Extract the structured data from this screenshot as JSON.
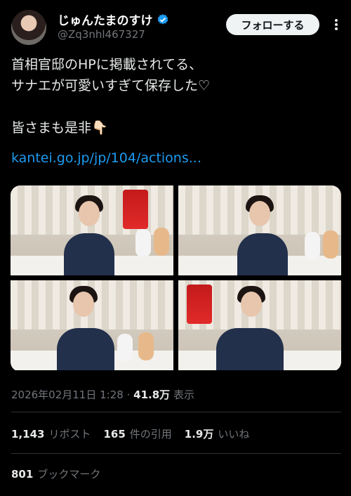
{
  "user": {
    "display_name": "じゅんたまのすけ",
    "handle": "@Zq3nhl467327",
    "verified_icon": "verified-badge-icon"
  },
  "header": {
    "follow_label": "フォローする",
    "more_icon": "more-icon"
  },
  "tweet": {
    "text": "首相官邸のHPに掲載されてる、\nサナエが可愛いすぎて保存した♡\n\n皆さまも是非👇🏻",
    "link": "kantei.go.jp/jp/104/actions..."
  },
  "media": {
    "count": 4
  },
  "meta": {
    "timestamp": "2026年02月11日 1:28",
    "separator": "·",
    "views_count": "41.8万",
    "views_label": "表示"
  },
  "stats": {
    "reposts_count": "1,143",
    "reposts_label": "リポスト",
    "quotes_count": "165",
    "quotes_label": "件の引用",
    "likes_count": "1.9万",
    "likes_label": "いいね"
  },
  "bookmarks": {
    "count": "801",
    "label": "ブックマーク"
  },
  "colors": {
    "background": "#000000",
    "link": "#1d9bf0",
    "muted": "#71767b",
    "verified": "#1d9bf0"
  }
}
